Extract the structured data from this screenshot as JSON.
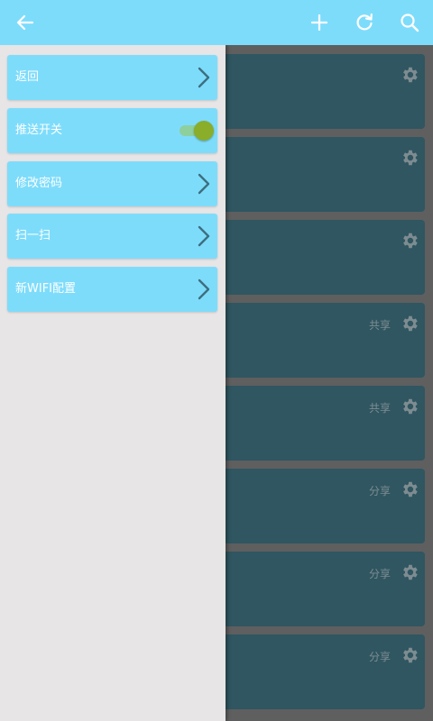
{
  "appbar": {
    "back_icon": "arrow-left-icon",
    "add_icon": "plus-icon",
    "refresh_icon": "refresh-icon",
    "search_icon": "search-icon",
    "color": "#7edcfb"
  },
  "drawer": {
    "items": [
      {
        "label": "返回",
        "control": "chevron"
      },
      {
        "label": "推送开关",
        "control": "toggle",
        "toggle_on": true
      },
      {
        "label": "修改密码",
        "control": "chevron"
      },
      {
        "label": "扫一扫",
        "control": "chevron"
      },
      {
        "label": "新WIFI配置",
        "control": "chevron"
      }
    ]
  },
  "devices": [
    {
      "tag": ""
    },
    {
      "tag": ""
    },
    {
      "tag": ""
    },
    {
      "tag": "共享"
    },
    {
      "tag": "共享"
    },
    {
      "tag": "分享"
    },
    {
      "tag": "分享"
    },
    {
      "tag": "分享"
    }
  ],
  "colors": {
    "accent": "#7edcfb",
    "drawer_bg": "#e7e5e6",
    "card_bg": "#2f5661",
    "toggle_thumb": "#8aad2a"
  }
}
